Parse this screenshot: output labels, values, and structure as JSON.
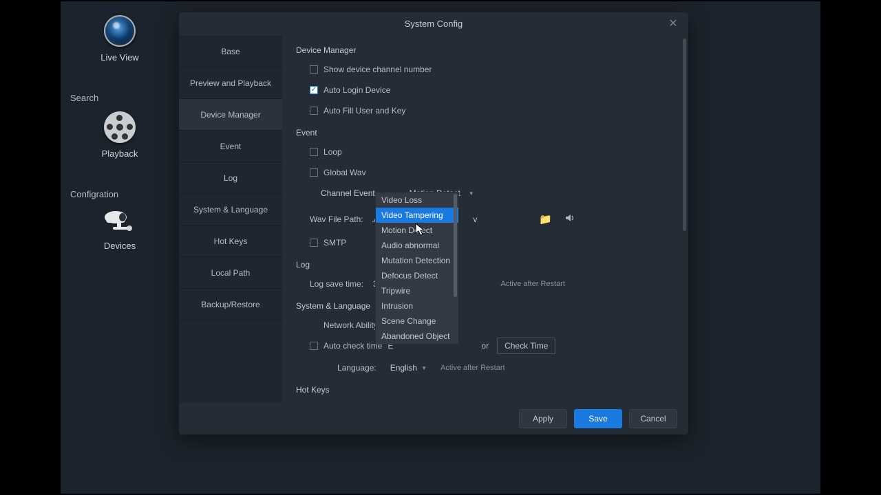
{
  "sidebar": {
    "live_view": "Live View",
    "search_section": "Search",
    "playback": "Playback",
    "config_section": "Configration",
    "devices": "Devices"
  },
  "dialog": {
    "title": "System Config",
    "nav": [
      "Base",
      "Preview and Playback",
      "Device Manager",
      "Event",
      "Log",
      "System & Language",
      "Hot Keys",
      "Local Path",
      "Backup/Restore"
    ],
    "active_nav_index": 2,
    "footer": {
      "apply": "Apply",
      "save": "Save",
      "cancel": "Cancel"
    }
  },
  "device_manager": {
    "heading": "Device Manager",
    "show_channel": "Show device channel number",
    "auto_login": "Auto Login Device",
    "auto_fill": "Auto Fill User and Key",
    "checks": {
      "show_channel": false,
      "auto_login": true,
      "auto_fill": false
    }
  },
  "event": {
    "heading": "Event",
    "loop": "Loop",
    "global_wav": "Global Wav",
    "channel_event_label": "Channel Event",
    "channel_event_dropdown": "Motion Detect",
    "wav_path_label": "Wav File Path:",
    "wav_path_value_left": "./so",
    "wav_path_value_right": "v",
    "smtp": "SMTP",
    "checks": {
      "loop": false,
      "global_wav": false,
      "smtp": false
    }
  },
  "dropdown_options": [
    "Video Loss",
    "Video Tampering",
    "Motion Detect",
    "Audio abnormal",
    "Mutation Detection",
    "Defocus Detect",
    "Tripwire",
    "Intrusion",
    "Scene Change",
    "Abandoned Object"
  ],
  "dropdown_hover_index": 1,
  "log": {
    "heading": "Log",
    "save_time_label": "Log save time:",
    "save_time_value": "30",
    "active_after_restart": "Active after Restart"
  },
  "syslang": {
    "heading": "System & Language",
    "network_ability_label": "Network Ability:",
    "auto_check_label": "Auto check time",
    "auto_check_prefix": "E",
    "or": "or",
    "check_time_btn": "Check Time",
    "language_label": "Language:",
    "language_value": "English",
    "active_after_restart": "Active after Restart",
    "checks": {
      "auto_check": false
    }
  },
  "hotkeys": {
    "heading": "Hot Keys"
  }
}
